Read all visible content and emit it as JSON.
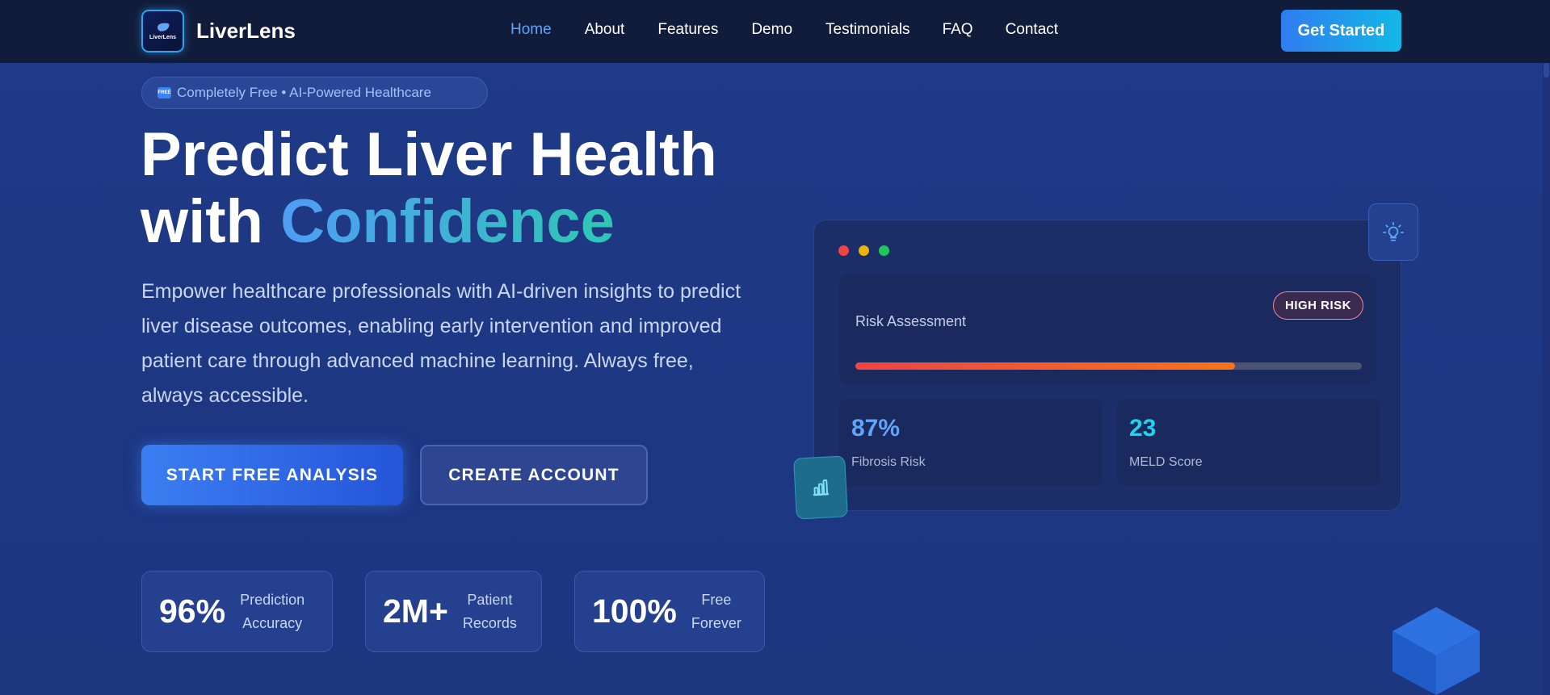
{
  "brand": {
    "name": "LiverLens",
    "logo_text": "LiverLens"
  },
  "nav": {
    "items": [
      {
        "label": "Home",
        "active": true
      },
      {
        "label": "About"
      },
      {
        "label": "Features"
      },
      {
        "label": "Demo"
      },
      {
        "label": "Testimonials"
      },
      {
        "label": "FAQ"
      },
      {
        "label": "Contact"
      }
    ],
    "cta_label": "Get Started"
  },
  "hero": {
    "badge": {
      "icon": "FREE",
      "text": "Completely Free • AI-Powered Healthcare"
    },
    "headline_line1": "Predict Liver Health",
    "headline_line2_prefix": "with ",
    "headline_line2_accent": "Confidence",
    "description": "Empower healthcare professionals with AI-driven insights to predict liver disease outcomes, enabling early intervention and improved patient care through advanced machine learning. Always free, always accessible.",
    "primary_cta": "START FREE ANALYSIS",
    "secondary_cta": "CREATE ACCOUNT"
  },
  "stats": [
    {
      "value": "96%",
      "label_line1": "Prediction",
      "label_line2": "Accuracy"
    },
    {
      "value": "2M+",
      "label_line1": "Patient",
      "label_line2": "Records"
    },
    {
      "value": "100%",
      "label_line1": "Free",
      "label_line2": "Forever"
    }
  ],
  "dashboard": {
    "risk_title": "Risk Assessment",
    "risk_badge": "HIGH RISK",
    "risk_level": 0.75,
    "metrics": [
      {
        "value": "87%",
        "label": "Fibrosis Risk",
        "color": "#60a5fa"
      },
      {
        "value": "23",
        "label": "MELD Score",
        "color": "#22d3ee"
      }
    ],
    "window_dots": [
      "#ef4444",
      "#eab308",
      "#22c55e"
    ]
  },
  "colors": {
    "accent": "#3b82f6",
    "nav_bg": "#111c3a",
    "page_bg": "#1f3a86",
    "risk_high": "#ef4444"
  }
}
